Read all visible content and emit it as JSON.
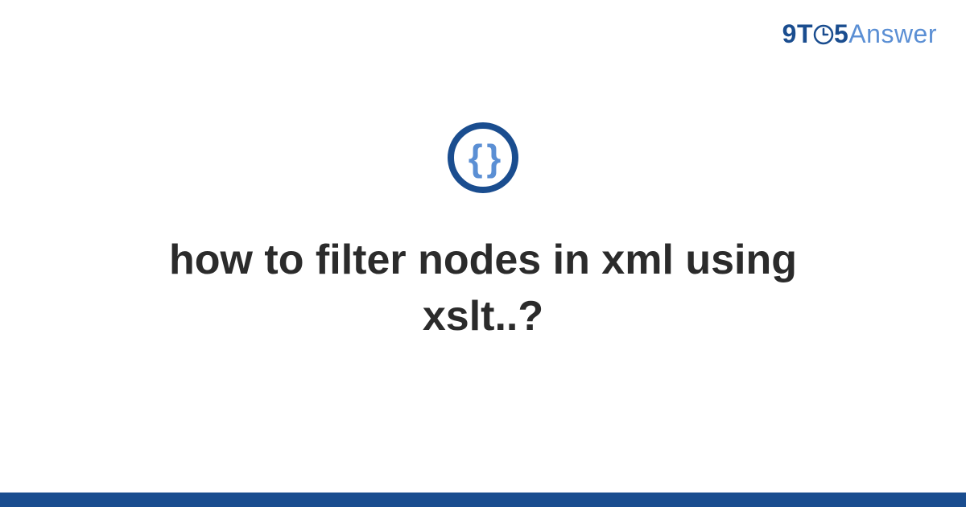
{
  "logo": {
    "part1": "9",
    "part2": "T",
    "part3": "5",
    "part4": "Answer"
  },
  "icon": {
    "glyph": "{ }",
    "name": "code-braces-icon"
  },
  "title": "how to filter nodes in xml using xslt..?",
  "colors": {
    "primary": "#1a4d8f",
    "secondary": "#5b8fd4",
    "text": "#2b2b2b"
  }
}
